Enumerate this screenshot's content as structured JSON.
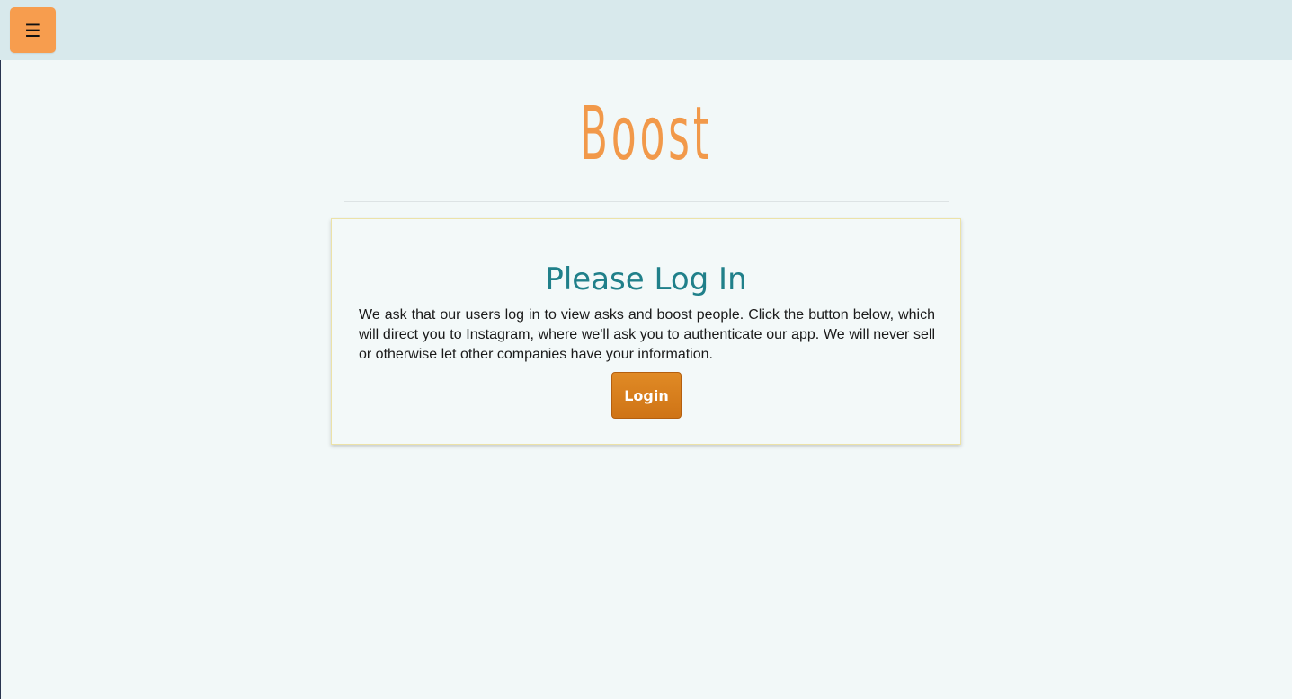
{
  "header": {
    "menu_icon": "☰",
    "menu_icon_name": "hamburger-menu-icon"
  },
  "brand": {
    "title": "Boost",
    "color": "#f2994a"
  },
  "login_card": {
    "title": "Please Log In",
    "body": "We ask that our users log in to view asks and boost people. Click the button below, which will direct you to Instagram, where we'll ask you to authenticate our app. We will never sell or otherwise let other companies have your information.",
    "button_label": "Login"
  },
  "colors": {
    "topbar": "#d8e9ec",
    "menu_button": "#f79d4e",
    "heading": "#20808a",
    "login_button": "#d67c1c",
    "background": "#f2f8f8"
  }
}
